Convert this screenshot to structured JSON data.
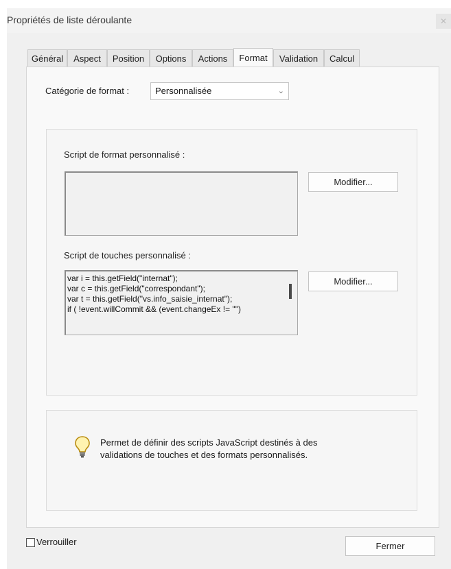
{
  "window": {
    "title": "Propriétés de liste déroulante"
  },
  "tabs": [
    {
      "label": "Général"
    },
    {
      "label": "Aspect"
    },
    {
      "label": "Position"
    },
    {
      "label": "Options"
    },
    {
      "label": "Actions"
    },
    {
      "label": "Format",
      "active": true
    },
    {
      "label": "Validation"
    },
    {
      "label": "Calcul"
    }
  ],
  "format": {
    "category_label": "Catégorie de format :",
    "category_value": "Personnalisée",
    "format_script_label": "Script de format personnalisé :",
    "format_script_button": "Modifier...",
    "keystroke_script_label": "Script de touches personnalisé :",
    "keystroke_script_lines": [
      "var i = this.getField(\"internat\");",
      "var c = this.getField(\"correspondant\");",
      "var t = this.getField(\"vs.info_saisie_internat\");",
      "",
      "if ( !event.willCommit && (event.changeEx != \"\")"
    ],
    "keystroke_script_button": "Modifier..."
  },
  "info": {
    "line1": "Permet de définir des scripts JavaScript destinés à des",
    "line2": "validations de touches et des formats personnalisés.",
    "icon": "lightbulb-icon"
  },
  "footer": {
    "lock_label": "Verrouiller",
    "lock_checked": false,
    "close_button": "Fermer"
  }
}
